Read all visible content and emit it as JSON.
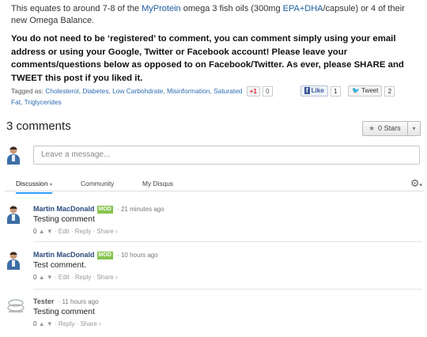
{
  "article": {
    "p1_a": "This equates to around 7-8 of the ",
    "p1_link1": "MyProtein",
    "p1_b": " omega 3 fish oils (300mg ",
    "p1_link2": "EPA+DHA",
    "p1_c": "/capsule) or 4 of their new Omega Balance.",
    "p2": "You do not need to be ‘registered’ to comment, you can comment simply using your email address or using your Google, Twitter or Facebook account! Please leave your comments/questions below as opposed to on Facebook/Twitter. As ever, please SHARE and TWEET this post if you liked it."
  },
  "tags": {
    "prefix": "Tagged as: ",
    "items": [
      "Cholesterol",
      "Diabetes",
      "Low Carbohdrate",
      "Misinformation",
      "Saturated",
      "Fat",
      "Triglycerides"
    ],
    "sep": ", "
  },
  "share": {
    "gplus_label": "+1",
    "gplus_count": "0",
    "fb_label": "Like",
    "fb_count": "1",
    "tw_label": "Tweet",
    "tw_count": "2"
  },
  "disqus": {
    "count_label": "3 comments",
    "stars_label": "0 Stars",
    "input_placeholder": "Leave a message...",
    "tabs": [
      "Discussion",
      "Community",
      "My Disqus"
    ]
  },
  "comments": [
    {
      "author": "Martin MacDonald",
      "badge": "MOD",
      "time": "21 minutes ago",
      "text": "Testing comment",
      "votes": "0",
      "actions": [
        "Edit",
        "Reply",
        "Share ›"
      ]
    },
    {
      "author": "Martin MacDonald",
      "badge": "MOD",
      "time": "10 hours ago",
      "text": "Test comment.",
      "votes": "0",
      "actions": [
        "Edit",
        "Reply",
        "Share ›"
      ]
    },
    {
      "author": "Tester",
      "badge": "",
      "time": "11 hours ago",
      "text": "Testing comment",
      "votes": "0",
      "actions": [
        "Reply",
        "Share ›"
      ]
    }
  ],
  "colors": {
    "link": "#1a5c9c",
    "mod_badge": "#86c44e",
    "tab_active": "#2e9fff"
  },
  "icons": [
    "user-avatar-icon",
    "star-icon",
    "chevron-down-icon",
    "gear-icon",
    "vote-up-icon",
    "vote-down-icon",
    "twitter-bird-icon",
    "facebook-icon"
  ]
}
